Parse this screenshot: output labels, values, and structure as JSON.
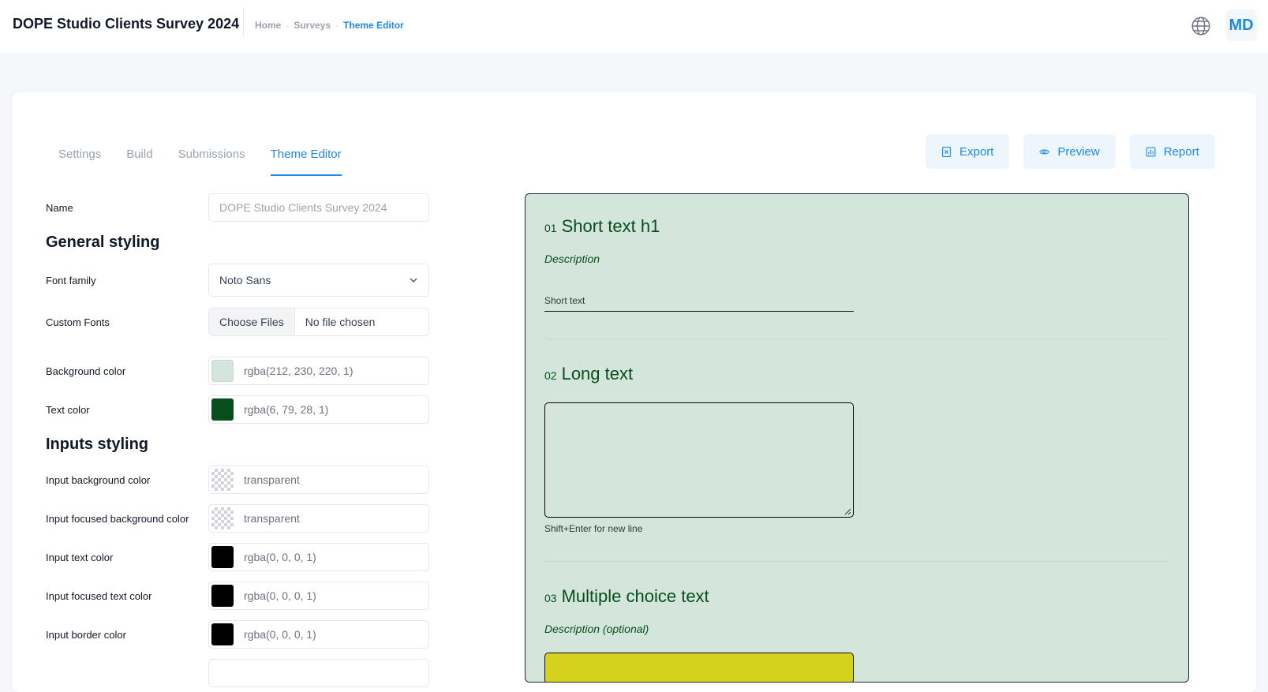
{
  "app": {
    "title": "DOPE Studio Clients Survey 2024"
  },
  "breadcrumb": {
    "items": [
      "Home",
      "Surveys",
      "Theme Editor"
    ]
  },
  "header": {
    "globe_icon": "globe-icon",
    "avatar_initials": "MD"
  },
  "tabs": [
    {
      "label": "Settings",
      "active": false
    },
    {
      "label": "Build",
      "active": false
    },
    {
      "label": "Submissions",
      "active": false
    },
    {
      "label": "Theme Editor",
      "active": true
    }
  ],
  "actions": {
    "export_label": "Export",
    "preview_label": "Preview",
    "report_label": "Report",
    "accent_color": "#1e88e5"
  },
  "settings": {
    "name_label": "Name",
    "name_placeholder": "DOPE Studio Clients Survey 2024",
    "general_title": "General styling",
    "font_family_label": "Font family",
    "font_family_value": "Noto Sans",
    "custom_fonts_label": "Custom Fonts",
    "choose_files_label": "Choose Files",
    "no_file_label": "No file chosen",
    "background_color_label": "Background color",
    "background_color_value": "rgba(212, 230, 220, 1)",
    "background_color_hex": "#d4e6dc",
    "text_color_label": "Text color",
    "text_color_value": "rgba(6, 79, 28, 1)",
    "text_color_hex": "#064f1c",
    "inputs_title": "Inputs styling",
    "input_bg_label": "Input background color",
    "input_bg_value": "transparent",
    "input_focused_bg_label": "Input focused background color",
    "input_focused_bg_value": "transparent",
    "input_text_label": "Input text color",
    "input_text_value": "rgba(0, 0, 0, 1)",
    "input_focused_text_label": "Input focused text color",
    "input_focused_text_value": "rgba(0, 0, 0, 1)",
    "input_border_label": "Input border color",
    "input_border_value": "rgba(0, 0, 0, 1)"
  },
  "preview": {
    "q1": {
      "num": "01",
      "title": "Short text h1",
      "description": "Description",
      "input_placeholder": "Short text"
    },
    "q2": {
      "num": "02",
      "title": "Long text",
      "hint": "Shift+Enter for new line"
    },
    "q3": {
      "num": "03",
      "title": "Multiple choice text",
      "description": "Description (optional)",
      "choice_color": "#d4d21c"
    }
  }
}
